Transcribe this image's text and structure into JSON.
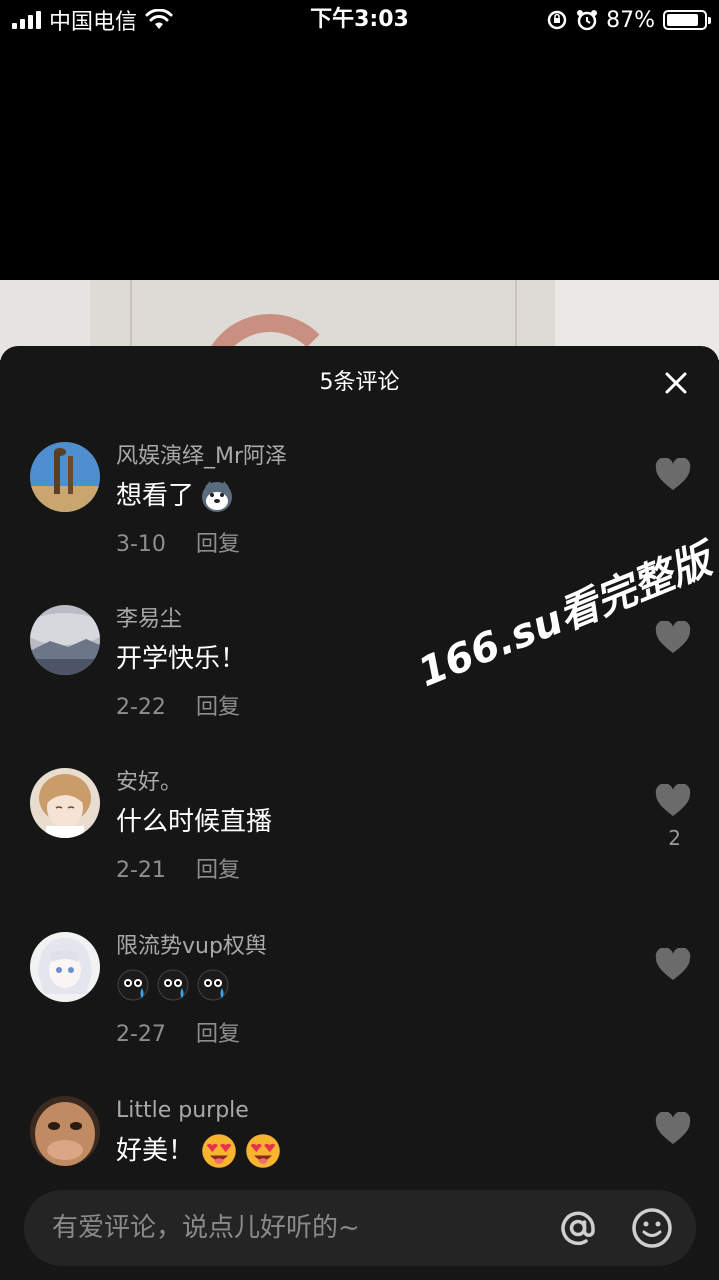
{
  "status_bar": {
    "carrier": "中国电信",
    "time": "下午3:03",
    "battery": "87%",
    "battery_level": 0.87
  },
  "sheet": {
    "title": "5条评论",
    "close_icon": "close-icon"
  },
  "comments": [
    {
      "name": "风娱演绎_Mr阿泽",
      "text": "想看了",
      "emoji": "husky-emoji",
      "date": "3-10",
      "reply": "回复",
      "likes": ""
    },
    {
      "name": "李易尘",
      "text": "开学快乐！",
      "emoji": "",
      "date": "2-22",
      "reply": "回复",
      "likes": ""
    },
    {
      "name": "安好。",
      "text": "什么时候直播",
      "emoji": "",
      "date": "2-21",
      "reply": "回复",
      "likes": "2"
    },
    {
      "name": "限流势vup权舆",
      "text": "",
      "emoji": "crying-emoji x3",
      "date": "2-27",
      "reply": "回复",
      "likes": ""
    },
    {
      "name": "Little purple",
      "text": "好美！",
      "emoji": "heart-eyes-emoji x2",
      "date": "",
      "reply": "",
      "likes": ""
    }
  ],
  "watermark": "166.su看完整版",
  "input": {
    "placeholder": "有爱评论，说点儿好听的~",
    "at_icon": "at-icon",
    "emoji_icon": "smile-icon"
  },
  "colors": {
    "sheet_bg": "#161616",
    "input_bg": "#242424",
    "name_gray": "#a9a9a9",
    "meta_gray": "#8e8e8e",
    "heart_gray": "#6b6b6b"
  }
}
